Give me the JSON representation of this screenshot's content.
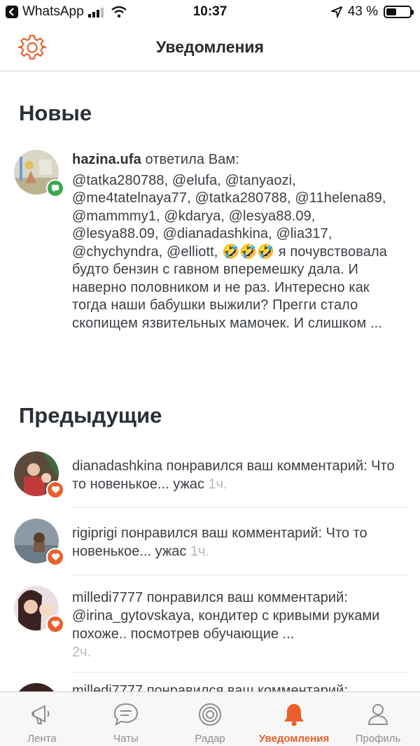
{
  "status_bar": {
    "back_app": "WhatsApp",
    "time": "10:37",
    "battery_percent": "43 %",
    "battery_level": 0.43
  },
  "header": {
    "title": "Уведомления",
    "settings_icon": "gear-icon"
  },
  "sections": {
    "new_title": "Новые",
    "previous_title": "Предыдущие"
  },
  "new_items": [
    {
      "user": "hazina.ufa",
      "action": " ответила Вам:",
      "body": "@tatka280788, @elufa, @tanyaozi, @me4tatelnaya77, @tatka280788, @11helena89, @mammmy1, @kdarya, @lesya88.09, @lesya88.09, @dianadashkina, @lia317, @chychyndra, @elliott, 🤣🤣🤣 я почувствовала будто бензин с гавном вперемешку дала. И наверно половником и не раз. Интересно как тогда наши бабушки выжили? Прегги стало скопищем язвительных мамочек. И слишком ...",
      "badge": "comment-badge-icon"
    }
  ],
  "previous_items": [
    {
      "text": "dianadashkina понравился ваш комментарий: Что то новенькое... ужас",
      "time": "1ч."
    },
    {
      "text": "rigiprigi понравился ваш комментарий: Что то новенькое... ужас",
      "time": "1ч."
    },
    {
      "text": "milledi7777 понравился ваш комментарий: @irina_gytovskaya, кондитер с кривыми руками похоже.. посмотрев обучающие ...",
      "time": "2ч."
    },
    {
      "text": "milledi7777 понравился ваш комментарий:",
      "time": ""
    }
  ],
  "tabs": [
    {
      "label": "Лента",
      "icon": "megaphone-icon",
      "active": false
    },
    {
      "label": "Чаты",
      "icon": "chat-icon",
      "active": false
    },
    {
      "label": "Радар",
      "icon": "radar-icon",
      "active": false
    },
    {
      "label": "Уведомления",
      "icon": "bell-icon",
      "active": true
    },
    {
      "label": "Профиль",
      "icon": "profile-icon",
      "active": false
    }
  ],
  "colors": {
    "accent": "#e8602c",
    "badge_green": "#3aa851",
    "time_gray": "#b5b8bb",
    "tab_gray": "#8a8e93"
  }
}
